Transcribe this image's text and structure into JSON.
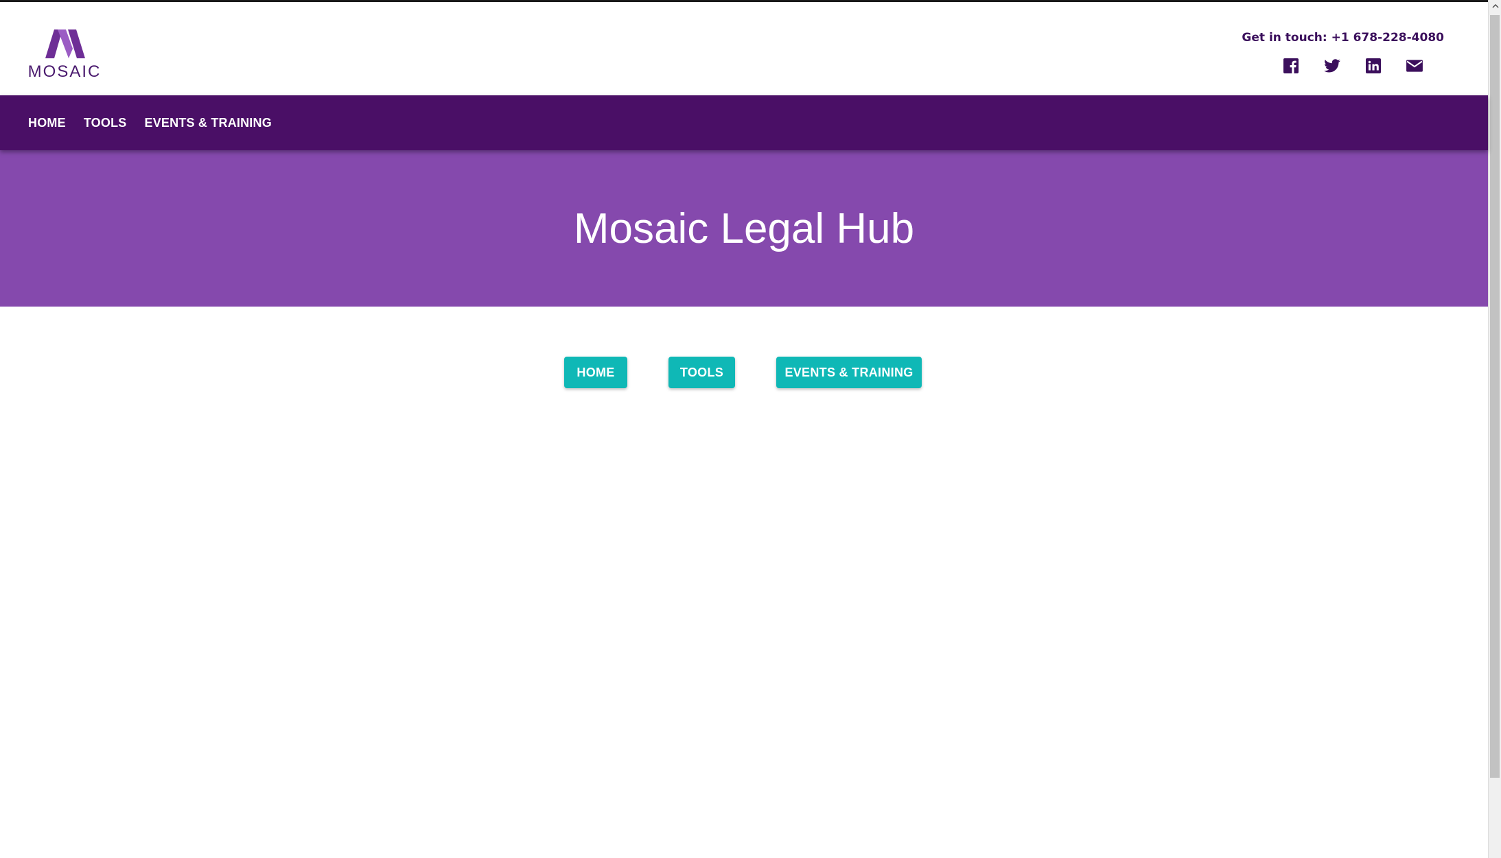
{
  "header": {
    "logo_text": "MOSAIC",
    "contact_text": "Get in touch: +1 678-228-4080",
    "social_icons": [
      "facebook-icon",
      "twitter-icon",
      "linkedin-icon",
      "mail-icon"
    ]
  },
  "navbar": {
    "items": [
      {
        "label": "HOME"
      },
      {
        "label": "TOOLS"
      },
      {
        "label": "EVENTS & TRAINING"
      }
    ]
  },
  "hero": {
    "title": "Mosaic Legal Hub"
  },
  "buttons": {
    "home_label": "HOME",
    "tools_label": "TOOLS",
    "events_label": "EVENTS & TRAINING"
  },
  "colors": {
    "brand_purple_dark": "#4a0f66",
    "hero_purple": "#8549ad",
    "accent_teal": "#0fb8b6",
    "text_purple": "#3b0f5c"
  }
}
